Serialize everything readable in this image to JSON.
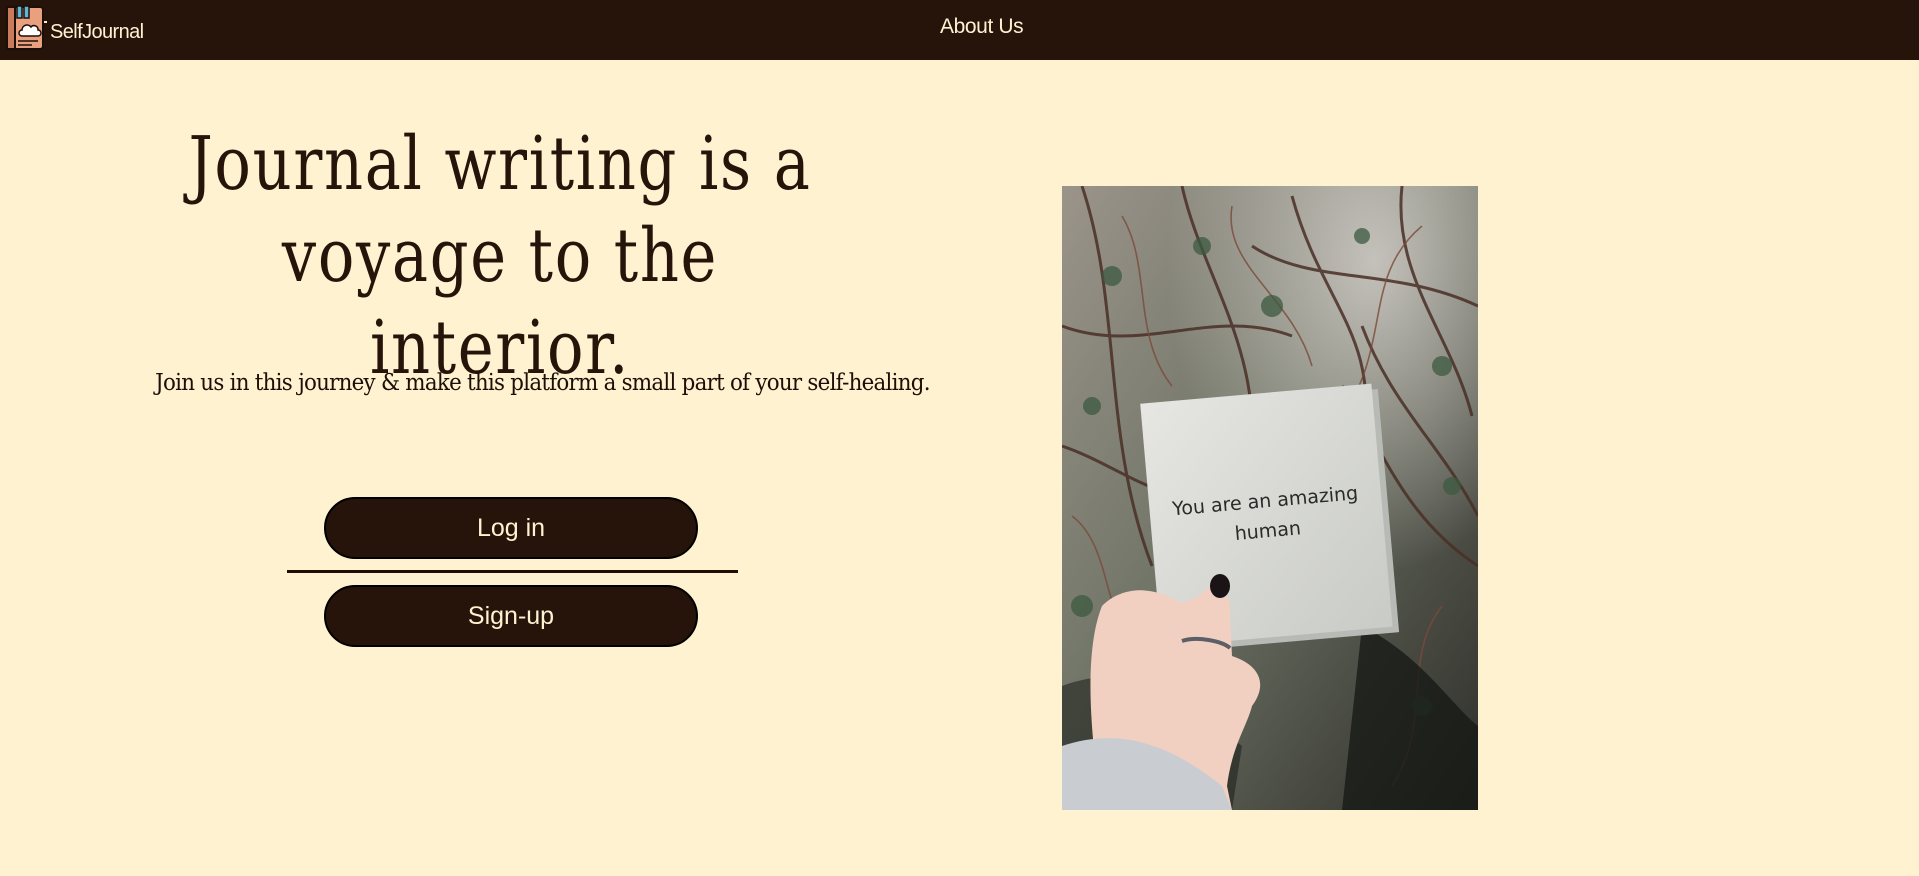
{
  "nav": {
    "brand_name": "SelfJournal",
    "about_link": "About Us",
    "logo_icon": "journal-cloud-icon"
  },
  "hero": {
    "title_line1": "Journal writing is a",
    "title_line2": "voyage to the interior.",
    "subtitle": "Join us in this journey & make this platform a small part of your self-healing."
  },
  "actions": {
    "login_label": "Log in",
    "signup_label": "Sign-up"
  },
  "image": {
    "alt": "Hand holding a note",
    "note_line1": "You are an amazing",
    "note_line2": "human"
  },
  "colors": {
    "background": "#fff2d1",
    "dark_brown": "#26140a",
    "cream_text": "#fff2d1"
  }
}
